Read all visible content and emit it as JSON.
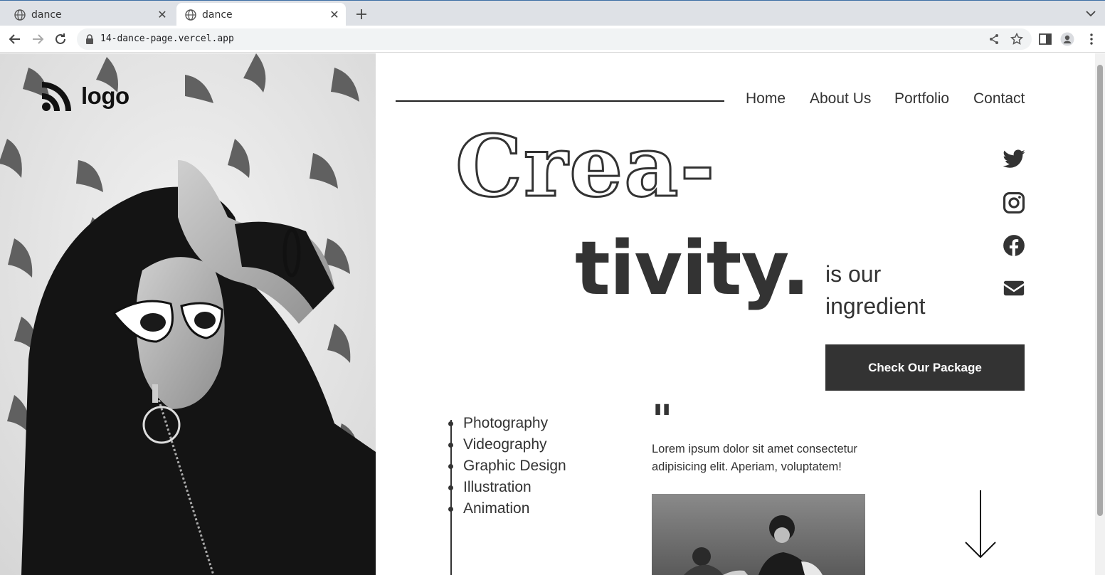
{
  "browser": {
    "tabs": [
      {
        "title": "dance",
        "active": false
      },
      {
        "title": "dance",
        "active": true
      }
    ],
    "url": "14-dance-page.vercel.app"
  },
  "site": {
    "logo_text": "logo",
    "nav": [
      "Home",
      "About Us",
      "Portfolio",
      "Contact"
    ],
    "headline_1": "Crea-",
    "headline_2": "tivity.",
    "tagline_1": "is our",
    "tagline_2": "ingredient",
    "cta_label": "Check Our Package",
    "social_icons": [
      "twitter-icon",
      "instagram-icon",
      "facebook-icon",
      "email-icon"
    ],
    "services": [
      "Photography",
      "Videography",
      "Graphic Design",
      "Illustration",
      "Animation"
    ],
    "quote_mark": "\"",
    "quote": "Lorem ipsum dolor sit amet consectetur adipisicing elit. Aperiam, voluptatem!",
    "colors": {
      "primary": "#333333",
      "background": "#ffffff",
      "chrome": "#dee1e6"
    }
  }
}
